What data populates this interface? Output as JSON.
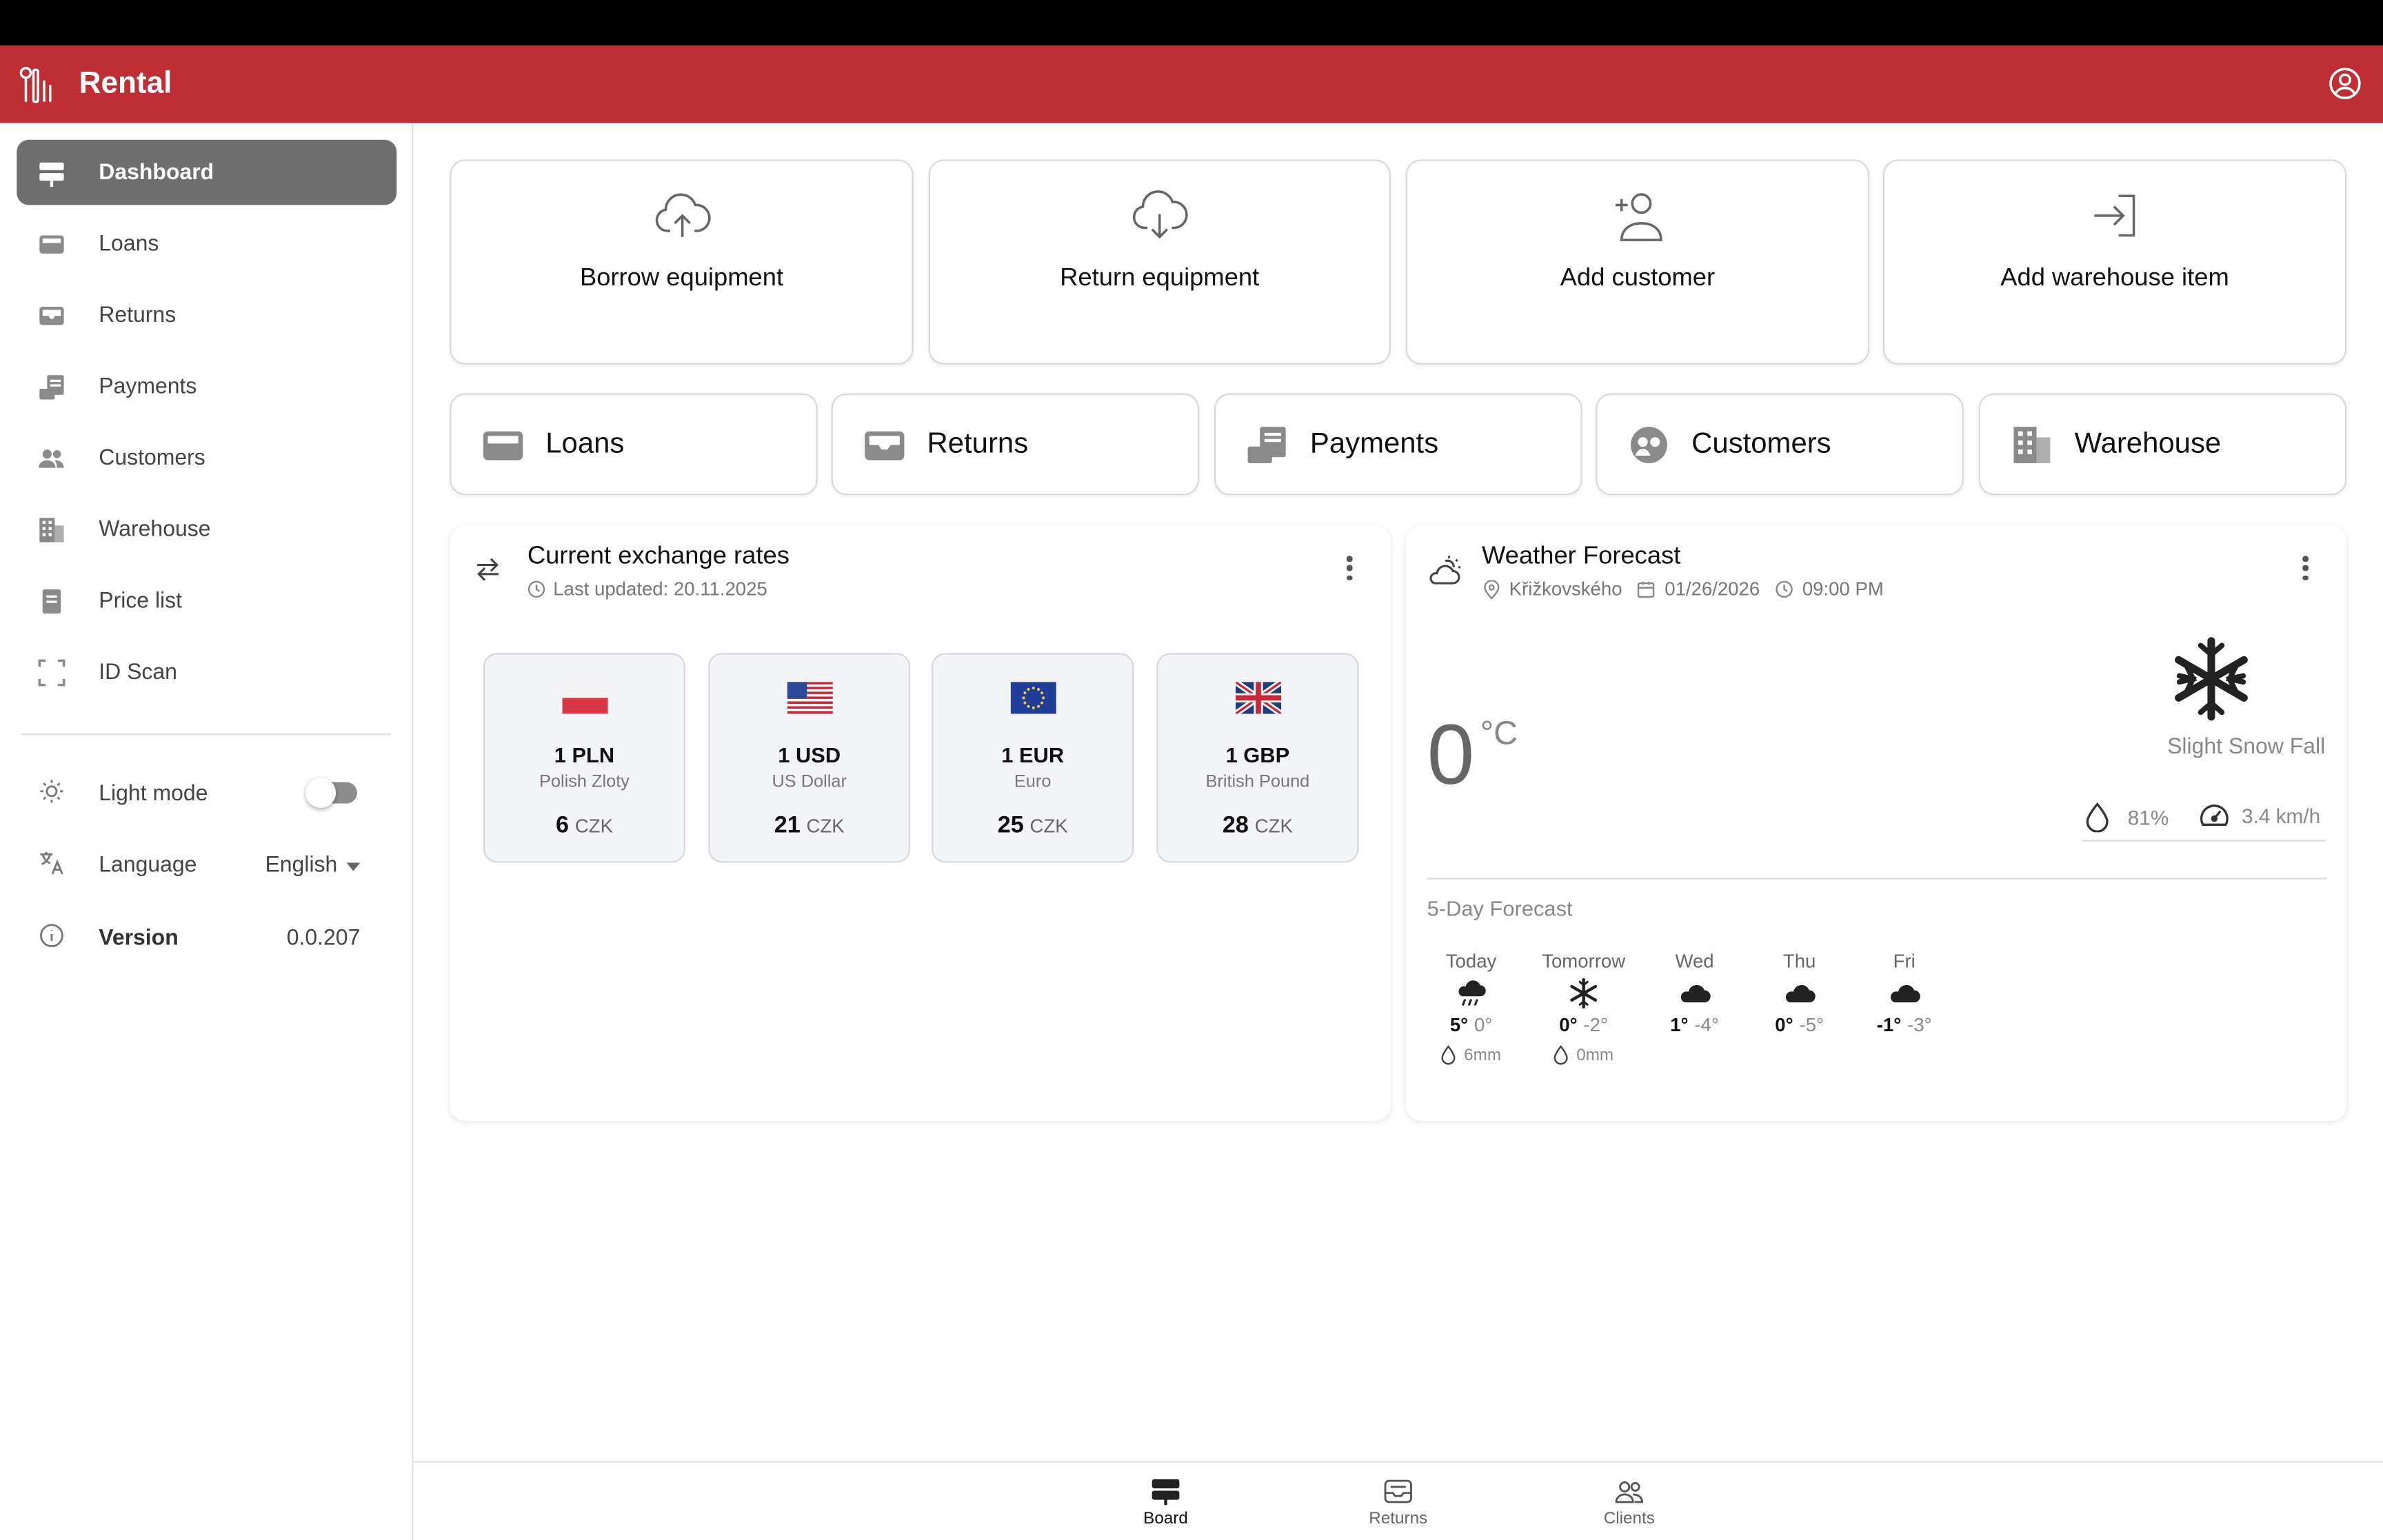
{
  "app": {
    "title": "Rental"
  },
  "sidebar": {
    "items": [
      {
        "label": "Dashboard",
        "icon": "signpost-icon",
        "active": true
      },
      {
        "label": "Loans",
        "icon": "tray-icon"
      },
      {
        "label": "Returns",
        "icon": "inbox-icon"
      },
      {
        "label": "Payments",
        "icon": "receipt-icon"
      },
      {
        "label": "Customers",
        "icon": "people-icon"
      },
      {
        "label": "Warehouse",
        "icon": "building-icon"
      },
      {
        "label": "Price list",
        "icon": "document-icon"
      },
      {
        "label": "ID Scan",
        "icon": "scan-frame-icon"
      }
    ],
    "settings": {
      "light_mode_label": "Light mode",
      "light_mode_on": false,
      "language_label": "Language",
      "language_value": "English",
      "version_label": "Version",
      "version_value": "0.0.207"
    }
  },
  "quick_actions": [
    {
      "label": "Borrow equipment",
      "icon": "cloud-upload-icon"
    },
    {
      "label": "Return equipment",
      "icon": "cloud-download-icon"
    },
    {
      "label": "Add customer",
      "icon": "add-person-icon"
    },
    {
      "label": "Add warehouse item",
      "icon": "login-arrow-icon"
    }
  ],
  "sections": [
    {
      "label": "Loans",
      "icon": "tray-icon"
    },
    {
      "label": "Returns",
      "icon": "inbox-icon"
    },
    {
      "label": "Payments",
      "icon": "receipt-icon"
    },
    {
      "label": "Customers",
      "icon": "people-icon"
    },
    {
      "label": "Warehouse",
      "icon": "building-icon"
    }
  ],
  "exchange": {
    "title": "Current exchange rates",
    "last_updated": "Last updated: 20.11.2025",
    "rates": [
      {
        "code": "1 PLN",
        "name": "Polish Zloty",
        "value": "6",
        "currency": "CZK",
        "flag": "poland-flag-icon"
      },
      {
        "code": "1 USD",
        "name": "US Dollar",
        "value": "21",
        "currency": "CZK",
        "flag": "usa-flag-icon"
      },
      {
        "code": "1 EUR",
        "name": "Euro",
        "value": "25",
        "currency": "CZK",
        "flag": "eu-flag-icon"
      },
      {
        "code": "1 GBP",
        "name": "British Pound",
        "value": "28",
        "currency": "CZK",
        "flag": "uk-flag-icon"
      }
    ]
  },
  "weather": {
    "title": "Weather Forecast",
    "location": "Křižkovského",
    "date": "01/26/2026",
    "time": "09:00 PM",
    "temperature": "0",
    "unit": "°C",
    "condition": "Slight Snow Fall",
    "humidity": "81%",
    "wind": "3.4 km/h",
    "forecast_title": "5-Day Forecast",
    "days": [
      {
        "name": "Today",
        "hi": "5°",
        "lo": "0°",
        "rain": "6mm",
        "icon": "rain-cloud-icon"
      },
      {
        "name": "Tomorrow",
        "hi": "0°",
        "lo": "-2°",
        "rain": "0mm",
        "icon": "snowflake-icon"
      },
      {
        "name": "Wed",
        "hi": "1°",
        "lo": "-4°",
        "icon": "cloud-icon"
      },
      {
        "name": "Thu",
        "hi": "0°",
        "lo": "-5°",
        "icon": "cloud-icon"
      },
      {
        "name": "Fri",
        "hi": "-1°",
        "lo": "-3°",
        "icon": "cloud-icon"
      }
    ]
  },
  "bottom_nav": [
    {
      "label": "Board",
      "icon": "signpost-icon",
      "active": true
    },
    {
      "label": "Returns",
      "icon": "inbox-icon"
    },
    {
      "label": "Clients",
      "icon": "people-icon"
    }
  ],
  "colors": {
    "brand": "#bf2e34",
    "active_nav": "#6e6e6e"
  }
}
